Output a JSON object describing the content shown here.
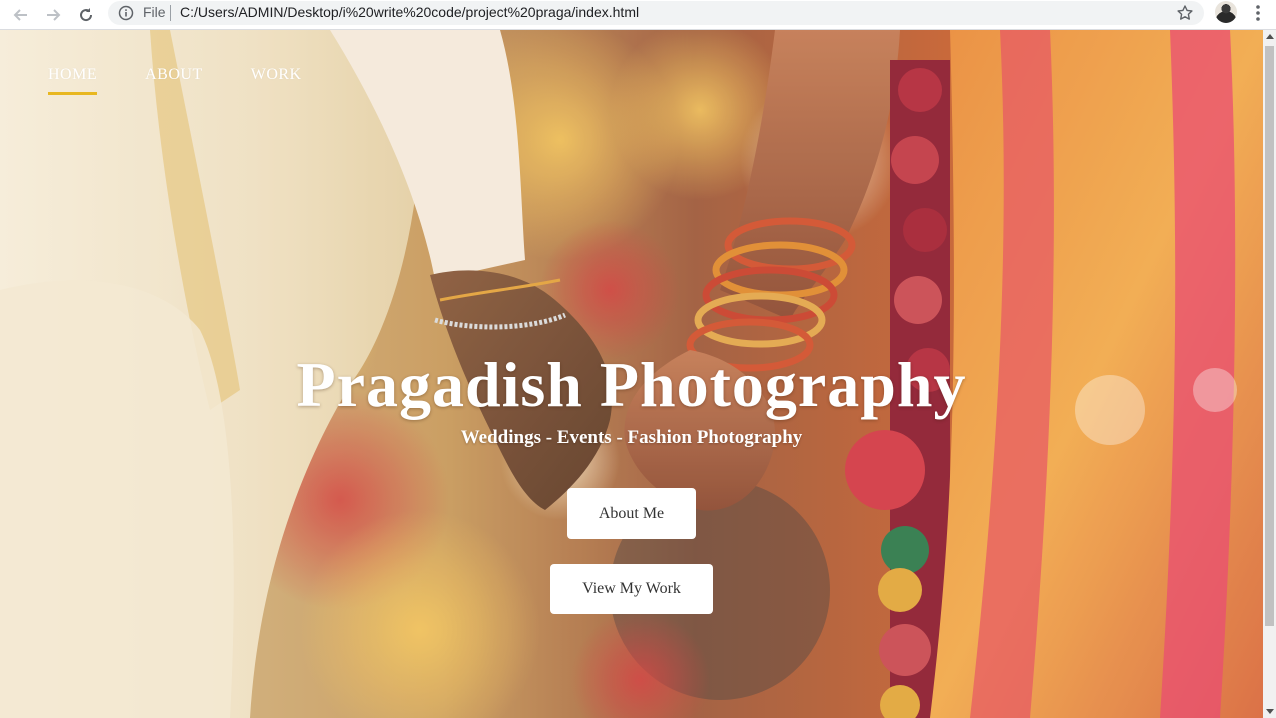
{
  "browser": {
    "file_label": "File",
    "url": "C:/Users/ADMIN/Desktop/i%20write%20code/project%20praga/index.html",
    "icons": [
      "back-arrow-icon",
      "forward-arrow-icon",
      "reload-icon",
      "info-icon",
      "star-icon",
      "profile-avatar",
      "kebab-menu-icon"
    ]
  },
  "nav": {
    "items": [
      {
        "label": "HOME",
        "active": true
      },
      {
        "label": "ABOUT",
        "active": false
      },
      {
        "label": "WORK",
        "active": false
      }
    ],
    "accent": "#e8b720"
  },
  "hero": {
    "title": "Pragadish Photography",
    "subtitle": "Weddings - Events - Fashion Photography",
    "buttons": {
      "about": "About Me",
      "work": "View My Work"
    }
  },
  "colors": {
    "text": "#ffffff",
    "button_bg": "#ffffff",
    "button_text": "#333333"
  }
}
